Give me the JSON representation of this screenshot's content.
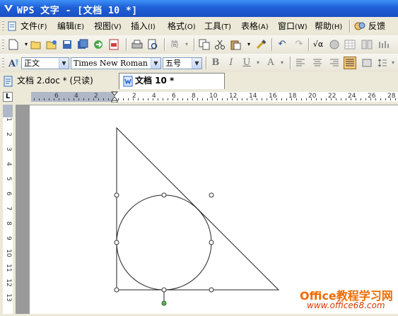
{
  "titlebar": {
    "title": "WPS 文字 - [文档 10 *]"
  },
  "menu": {
    "items": [
      {
        "label": "文件",
        "accel": "(F)"
      },
      {
        "label": "编辑",
        "accel": "(E)"
      },
      {
        "label": "视图",
        "accel": "(V)"
      },
      {
        "label": "插入",
        "accel": "(I)"
      },
      {
        "label": "格式",
        "accel": "(O)"
      },
      {
        "label": "工具",
        "accel": "(T)"
      },
      {
        "label": "表格",
        "accel": "(A)"
      },
      {
        "label": "窗口",
        "accel": "(W)"
      },
      {
        "label": "帮助",
        "accel": "(H)"
      }
    ],
    "feedback": "反馈"
  },
  "format": {
    "style": "正文",
    "font": "Times New Roman",
    "size": "五号",
    "bold": "B",
    "italic": "I",
    "underline": "U",
    "font_color": "A"
  },
  "tabs": [
    {
      "label": "文档 2.doc * (只读)"
    },
    {
      "label": "文档 10 *"
    }
  ],
  "ruler": {
    "top_left": [
      "6",
      "4",
      "2"
    ],
    "top_right": [
      "2",
      "4",
      "6",
      "8",
      "10",
      "12",
      "14",
      "16",
      "18",
      "20",
      "22",
      "24",
      "26",
      "28"
    ],
    "left": [
      "1",
      "2",
      "3",
      "4",
      "5",
      "6",
      "7",
      "8",
      "9",
      "10",
      "11",
      "12",
      "13"
    ],
    "corner": "L"
  },
  "watermark": {
    "line1": "Office教程学习网",
    "line2": "www.office68.com"
  },
  "colors": {
    "titlebar": "#1f5fd6",
    "active_align": "#f7c67b",
    "watermark": "#f06a00"
  }
}
